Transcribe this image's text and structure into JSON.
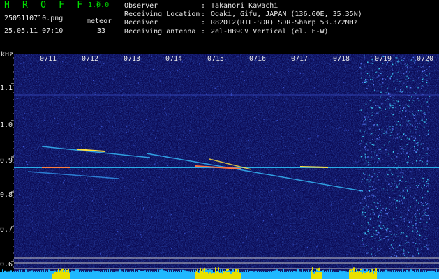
{
  "header": {
    "app_title": "H R O F F T",
    "version": "1.0.0",
    "file_name": "2505110710.png",
    "meteor_label": "meteor",
    "datetime": "25.05.11 07:10",
    "meteor_count": "33",
    "info_rows": [
      {
        "key": "Observer",
        "value": "Takanori Kawachi"
      },
      {
        "key": "Receiving Location",
        "value": "Ogaki, Gifu, JAPAN (136.60E, 35.35N)"
      },
      {
        "key": "Receiver",
        "value": "R820T2(RTL-SDR) SDR-Sharp 53.372MHz"
      },
      {
        "key": "Receiving antenna",
        "value": "2el-HB9CV Vertical (el. E-W)"
      }
    ],
    "separator": ":"
  },
  "axis": {
    "unit": "kHz",
    "y_ticks": [
      "1.1",
      "1.0",
      "0.9",
      "0.8",
      "0.7",
      "0.6"
    ],
    "time_ticks": [
      "0711",
      "0712",
      "0713",
      "0714",
      "0715",
      "0716",
      "0717",
      "0718",
      "0719",
      "0720"
    ]
  },
  "colors": {
    "background": "#0a0a5a",
    "title_green": "#00e000",
    "signal_cyan": "#3fd8ff",
    "level_yellow": "#e8e000"
  }
}
